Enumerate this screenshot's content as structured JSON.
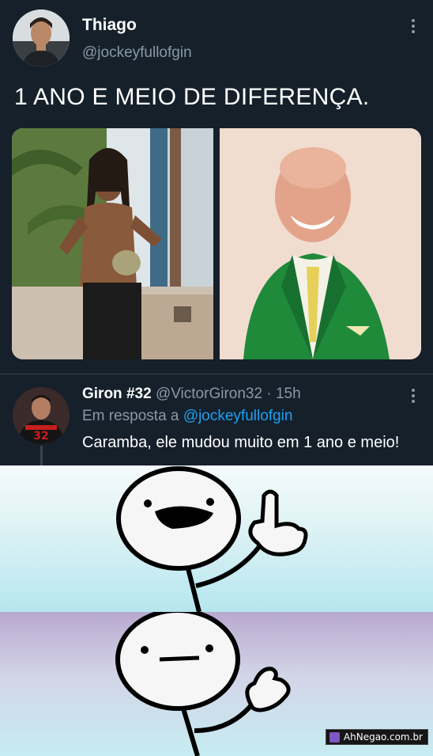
{
  "tweet": {
    "name": "Thiago",
    "handle": "@jockeyfullofgin",
    "text": "1 ANO E MEIO DE DIFERENÇA."
  },
  "reply": {
    "name": "Giron #32",
    "handle": "@VictorGiron32",
    "separator": "·",
    "time": "15h",
    "reply_prefix": "Em resposta a",
    "reply_mention": "@jockeyfullofgin",
    "text": "Caramba, ele mudou muito em 1 ano e meio!"
  },
  "watermark": "AhNegao.com.br",
  "colors": {
    "background": "#15202b",
    "secondary_text": "#8899a6",
    "mention": "#1da1f2",
    "jacket_green": "#1f8a3a"
  },
  "icons": [
    "more-options-icon"
  ]
}
